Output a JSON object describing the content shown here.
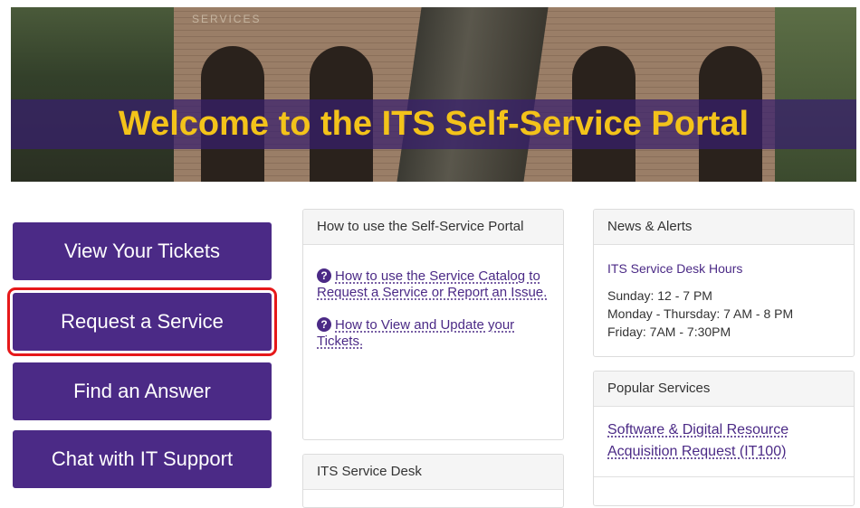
{
  "hero": {
    "sign_text": "SERVICES",
    "title": "Welcome to the ITS Self-Service Portal"
  },
  "actions": [
    {
      "label": "View Your Tickets"
    },
    {
      "label": "Request a Service"
    },
    {
      "label": "Find an Answer"
    },
    {
      "label": "Chat with IT Support"
    }
  ],
  "howto": {
    "header": "How to use the Self-Service Portal",
    "links": [
      "How to use the Service Catalog to Request a Service or Report an Issue.",
      "How to View and Update your Tickets."
    ]
  },
  "service_desk": {
    "header": "ITS Service Desk"
  },
  "news": {
    "header": "News & Alerts",
    "hours_title": "ITS Service Desk Hours",
    "hours": [
      "Sunday: 12 - 7 PM",
      "Monday - Thursday: 7 AM - 8 PM",
      "Friday: 7AM - 7:30PM"
    ]
  },
  "popular": {
    "header": "Popular Services",
    "links": [
      "Software & Digital Resource Acquisition Request (IT100)"
    ]
  },
  "colors": {
    "brand_purple": "#4b2a86",
    "title_gold": "#f3c31a",
    "highlight_red": "#e6181a"
  },
  "icons": [
    "question-circle-icon"
  ]
}
